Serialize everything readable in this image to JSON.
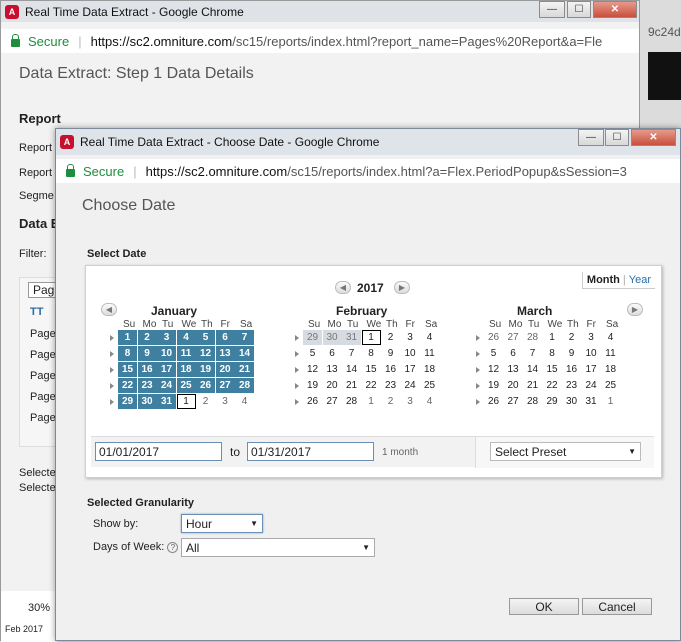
{
  "bg_window": {
    "title": "Real Time Data Extract - Google Chrome",
    "secure": "Secure",
    "url_host": "https://sc2.omniture.com",
    "url_path": "/sc15/reports/index.html?report_name=Pages%20Report&a=Fle",
    "header": "Data Extract: Step 1 Data Details",
    "section_report": "Report",
    "label_report": "Report",
    "label_report2": "Report",
    "label_segment": "Segme",
    "section_data": "Data E",
    "filter": "Filter:",
    "tab_page": "Pag",
    "toolbar_t": "T",
    "rows": [
      "Pages",
      "Pages",
      "Pages",
      "Pages",
      "Pages"
    ],
    "selected1": "Selecte",
    "selected2": "Selecte",
    "pct": "30%",
    "bottom_date": "Feb 2017",
    "right_tab_text": "9c24d"
  },
  "dialog": {
    "title": "Real Time Data Extract - Choose Date - Google Chrome",
    "secure": "Secure",
    "url_host": "https://sc2.omniture.com",
    "url_path": "/sc15/reports/index.html?a=Flex.PeriodPopup&sSession=3",
    "header": "Choose Date",
    "select_date_label": "Select Date",
    "year": "2017",
    "tab_month": "Month",
    "tab_year": "Year",
    "tab_sep": "|",
    "day_headers": [
      "Su",
      "Mo",
      "Tu",
      "We",
      "Th",
      "Fr",
      "Sa"
    ],
    "months": [
      {
        "name": "January",
        "weeks": [
          [
            {
              "d": "1",
              "s": "sel"
            },
            {
              "d": "2",
              "s": "sel"
            },
            {
              "d": "3",
              "s": "sel"
            },
            {
              "d": "4",
              "s": "sel"
            },
            {
              "d": "5",
              "s": "sel"
            },
            {
              "d": "6",
              "s": "sel"
            },
            {
              "d": "7",
              "s": "sel"
            }
          ],
          [
            {
              "d": "8",
              "s": "sel"
            },
            {
              "d": "9",
              "s": "sel"
            },
            {
              "d": "10",
              "s": "sel"
            },
            {
              "d": "11",
              "s": "sel"
            },
            {
              "d": "12",
              "s": "sel"
            },
            {
              "d": "13",
              "s": "sel"
            },
            {
              "d": "14",
              "s": "sel"
            }
          ],
          [
            {
              "d": "15",
              "s": "sel"
            },
            {
              "d": "16",
              "s": "sel"
            },
            {
              "d": "17",
              "s": "sel"
            },
            {
              "d": "18",
              "s": "sel"
            },
            {
              "d": "19",
              "s": "sel"
            },
            {
              "d": "20",
              "s": "sel"
            },
            {
              "d": "21",
              "s": "sel"
            }
          ],
          [
            {
              "d": "22",
              "s": "sel"
            },
            {
              "d": "23",
              "s": "sel"
            },
            {
              "d": "24",
              "s": "sel"
            },
            {
              "d": "25",
              "s": "sel"
            },
            {
              "d": "26",
              "s": "sel"
            },
            {
              "d": "27",
              "s": "sel"
            },
            {
              "d": "28",
              "s": "sel"
            }
          ],
          [
            {
              "d": "29",
              "s": "sel"
            },
            {
              "d": "30",
              "s": "sel"
            },
            {
              "d": "31",
              "s": "sel"
            },
            {
              "d": "1",
              "s": "today"
            },
            {
              "d": "2",
              "s": "other"
            },
            {
              "d": "3",
              "s": "other"
            },
            {
              "d": "4",
              "s": "other"
            }
          ]
        ]
      },
      {
        "name": "February",
        "weeks": [
          [
            {
              "d": "29",
              "s": "disabled"
            },
            {
              "d": "30",
              "s": "disabled"
            },
            {
              "d": "31",
              "s": "disabled"
            },
            {
              "d": "1",
              "s": "today"
            },
            {
              "d": "2",
              "s": ""
            },
            {
              "d": "3",
              "s": ""
            },
            {
              "d": "4",
              "s": ""
            }
          ],
          [
            {
              "d": "5",
              "s": ""
            },
            {
              "d": "6",
              "s": ""
            },
            {
              "d": "7",
              "s": ""
            },
            {
              "d": "8",
              "s": ""
            },
            {
              "d": "9",
              "s": ""
            },
            {
              "d": "10",
              "s": ""
            },
            {
              "d": "11",
              "s": ""
            }
          ],
          [
            {
              "d": "12",
              "s": ""
            },
            {
              "d": "13",
              "s": ""
            },
            {
              "d": "14",
              "s": ""
            },
            {
              "d": "15",
              "s": ""
            },
            {
              "d": "16",
              "s": ""
            },
            {
              "d": "17",
              "s": ""
            },
            {
              "d": "18",
              "s": ""
            }
          ],
          [
            {
              "d": "19",
              "s": ""
            },
            {
              "d": "20",
              "s": ""
            },
            {
              "d": "21",
              "s": ""
            },
            {
              "d": "22",
              "s": ""
            },
            {
              "d": "23",
              "s": ""
            },
            {
              "d": "24",
              "s": ""
            },
            {
              "d": "25",
              "s": ""
            }
          ],
          [
            {
              "d": "26",
              "s": ""
            },
            {
              "d": "27",
              "s": ""
            },
            {
              "d": "28",
              "s": ""
            },
            {
              "d": "1",
              "s": "other"
            },
            {
              "d": "2",
              "s": "other"
            },
            {
              "d": "3",
              "s": "other"
            },
            {
              "d": "4",
              "s": "other"
            }
          ]
        ]
      },
      {
        "name": "March",
        "weeks": [
          [
            {
              "d": "26",
              "s": "other"
            },
            {
              "d": "27",
              "s": "other"
            },
            {
              "d": "28",
              "s": "other"
            },
            {
              "d": "1",
              "s": ""
            },
            {
              "d": "2",
              "s": ""
            },
            {
              "d": "3",
              "s": ""
            },
            {
              "d": "4",
              "s": ""
            }
          ],
          [
            {
              "d": "5",
              "s": ""
            },
            {
              "d": "6",
              "s": ""
            },
            {
              "d": "7",
              "s": ""
            },
            {
              "d": "8",
              "s": ""
            },
            {
              "d": "9",
              "s": ""
            },
            {
              "d": "10",
              "s": ""
            },
            {
              "d": "11",
              "s": ""
            }
          ],
          [
            {
              "d": "12",
              "s": ""
            },
            {
              "d": "13",
              "s": ""
            },
            {
              "d": "14",
              "s": ""
            },
            {
              "d": "15",
              "s": ""
            },
            {
              "d": "16",
              "s": ""
            },
            {
              "d": "17",
              "s": ""
            },
            {
              "d": "18",
              "s": ""
            }
          ],
          [
            {
              "d": "19",
              "s": ""
            },
            {
              "d": "20",
              "s": ""
            },
            {
              "d": "21",
              "s": ""
            },
            {
              "d": "22",
              "s": ""
            },
            {
              "d": "23",
              "s": ""
            },
            {
              "d": "24",
              "s": ""
            },
            {
              "d": "25",
              "s": ""
            }
          ],
          [
            {
              "d": "26",
              "s": ""
            },
            {
              "d": "27",
              "s": ""
            },
            {
              "d": "28",
              "s": ""
            },
            {
              "d": "29",
              "s": ""
            },
            {
              "d": "30",
              "s": ""
            },
            {
              "d": "31",
              "s": ""
            },
            {
              "d": "1",
              "s": "other"
            }
          ]
        ]
      }
    ],
    "start_date": "01/01/2017",
    "to": "to",
    "end_date": "01/31/2017",
    "duration": "1 month",
    "preset": "Select Preset",
    "granularity_label": "Selected Granularity",
    "show_by_label": "Show by:",
    "show_by_value": "Hour",
    "dow_label": "Days of Week:",
    "dow_value": "All",
    "help_icon": "?",
    "ok": "OK",
    "cancel": "Cancel"
  },
  "colors": {
    "selected": "#3f7fa0",
    "secure_green": "#1e8e3e",
    "brand_red": "#c8102e"
  }
}
